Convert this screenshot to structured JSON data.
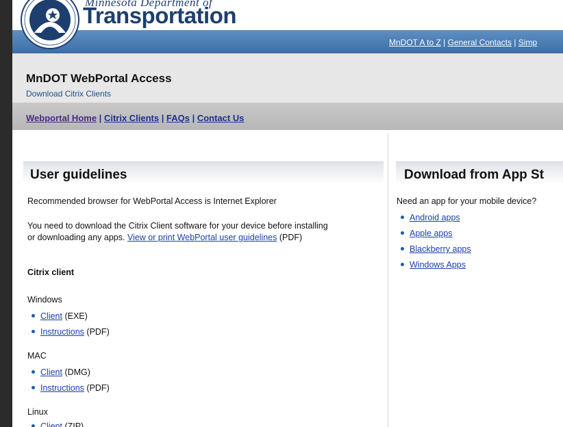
{
  "header": {
    "agency_line": "Minnesota Department of",
    "brand": "Transportation",
    "top_links": [
      "MnDOT A to Z",
      "General Contacts",
      "Simp"
    ],
    "top_link_sep": " | "
  },
  "site": {
    "title": "MnDOT WebPortal Access",
    "subtitle": "Download Citrix Clients"
  },
  "nav": {
    "items": [
      "Webportal Home",
      "Citrix Clients",
      "FAQs",
      "Contact Us"
    ],
    "sep": " | "
  },
  "guidelines": {
    "heading": "User guidelines",
    "browser_note": "Recommended browser for WebPortal Access is Internet Explorer",
    "download_note_line1": "You need to download the Citrix Client software for your device before installing",
    "download_note_line2_prefix": "or downloading any apps.",
    "guidelines_link": "View or print WebPortal user guidelines",
    "guidelines_suffix": "(PDF)",
    "citrix_heading": "Citrix client",
    "platforms": [
      {
        "name": "Windows",
        "items": [
          {
            "link": "Client",
            "suffix": "(EXE)"
          },
          {
            "link": "Instructions",
            "suffix": "(PDF)"
          }
        ]
      },
      {
        "name": "MAC",
        "items": [
          {
            "link": "Client",
            "suffix": "(DMG)"
          },
          {
            "link": "Instructions",
            "suffix": "(PDF)"
          }
        ]
      },
      {
        "name": "Linux",
        "items": [
          {
            "link": "Client",
            "suffix": "(ZIP)"
          }
        ]
      }
    ]
  },
  "appstore": {
    "heading": "Download from App St",
    "question": "Need an app for your mobile device?",
    "links": [
      "Android apps",
      "Apple apps",
      "Blackberry apps",
      "Windows Apps"
    ]
  },
  "colors": {
    "brand_blue": "#1e3f6e",
    "header_bar": "#3d6ea5",
    "link": "#1b3fa8"
  }
}
